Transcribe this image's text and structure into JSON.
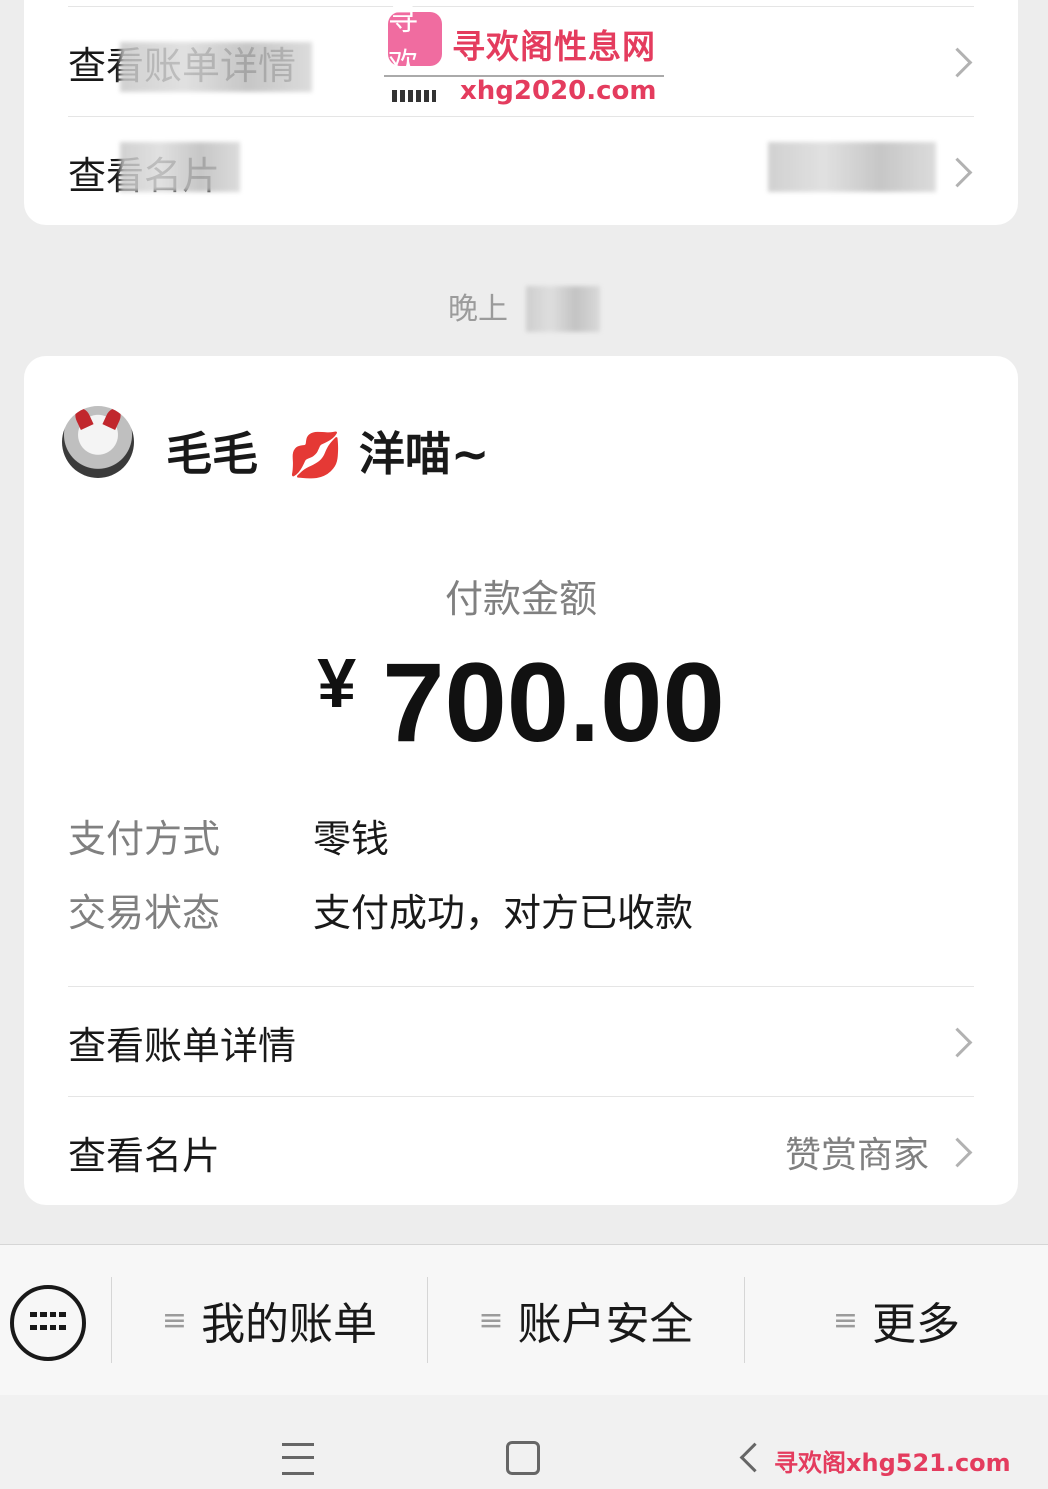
{
  "top_card": {
    "row1_label": "查看账单详情",
    "row2_label": "查看名片"
  },
  "watermark": {
    "badge": "寻欢",
    "title": "寻欢阁性息网",
    "url": "xhg2020.com",
    "bottom": "寻欢阁xhg521.com"
  },
  "timestamp": "晚上",
  "payment": {
    "payer_name": "毛毛",
    "merchant_emoji": "💋",
    "merchant_name": "洋喵~",
    "amount_title": "付款金额",
    "currency_symbol": "¥",
    "amount": "700.00",
    "method_label": "支付方式",
    "method_value": "零钱",
    "status_label": "交易状态",
    "status_value": "支付成功，对方已收款",
    "bill_label": "查看账单详情",
    "card_label": "查看名片",
    "card_value": "赞赏商家"
  },
  "menu": {
    "items": [
      "我的账单",
      "账户安全",
      "更多"
    ]
  },
  "colors": {
    "background": "#ededed",
    "card": "#ffffff",
    "watermark": "#e43c5e"
  }
}
